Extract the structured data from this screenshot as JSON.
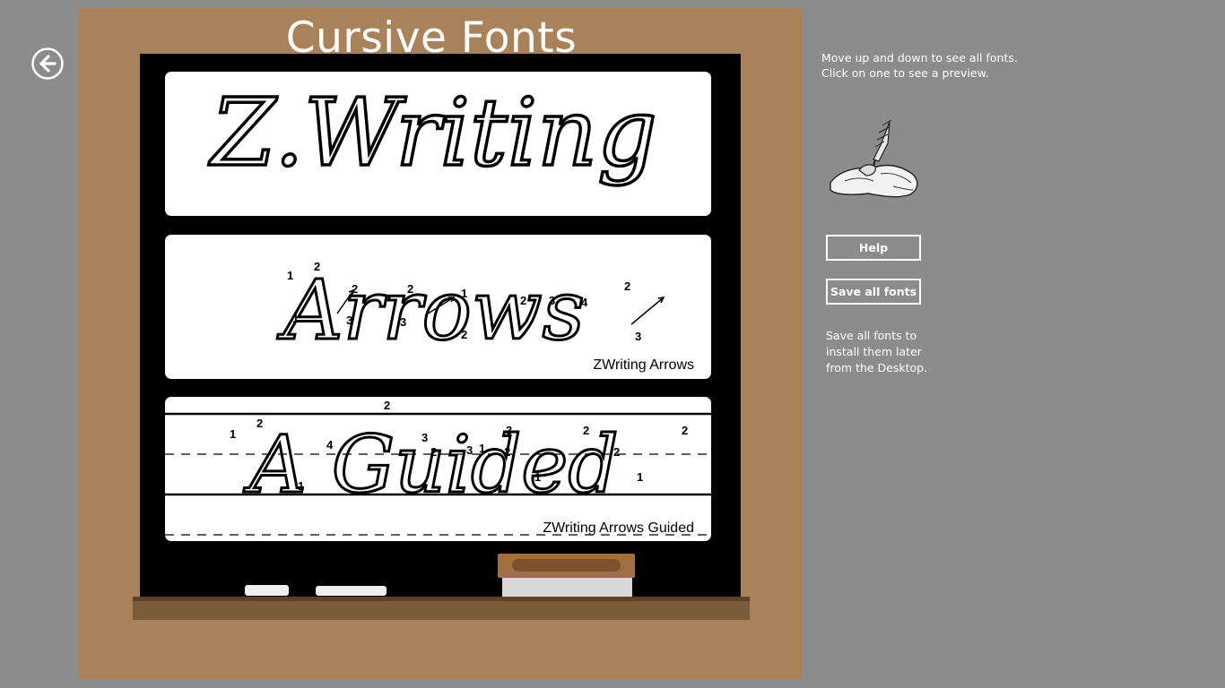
{
  "header": {
    "title": "Cursive Fonts",
    "back_icon": "back-arrow-icon"
  },
  "fonts": [
    {
      "preview_text": "Z.Writing",
      "label": ""
    },
    {
      "preview_text": "Arrows",
      "label": "ZWriting Arrows"
    },
    {
      "preview_text": "A Guided",
      "label": "ZWriting Arrows Guided"
    }
  ],
  "sidebar": {
    "instruction_line1": "Move up and down to see all fonts.",
    "instruction_line2": "Click on one to see a preview.",
    "quill_icon": "quill-hand-icon",
    "help_label": "Help",
    "save_all_label": "Save all fonts",
    "save_note_line1": "Save all fonts to",
    "save_note_line2": "install them later",
    "save_note_line3": "from the Desktop."
  },
  "colors": {
    "background": "#8c8c8c",
    "board_frame": "#a9825a",
    "chalkboard": "#000000",
    "card": "#ffffff"
  }
}
